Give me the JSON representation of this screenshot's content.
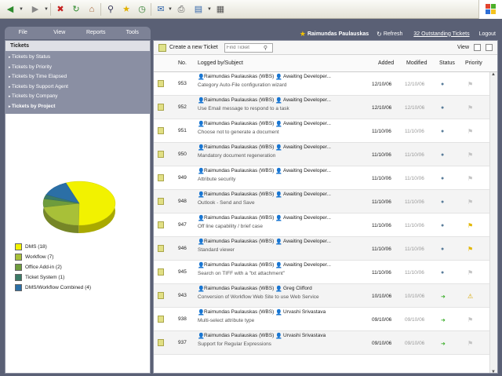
{
  "toolbar": {
    "icons": [
      "back-icon",
      "forward-icon",
      "stop-icon",
      "refresh-icon",
      "home-icon",
      "search-icon",
      "favorites-icon",
      "history-icon",
      "mail-icon",
      "print-icon",
      "edit-icon",
      "discuss-icon"
    ]
  },
  "menu": {
    "items": [
      "File",
      "View",
      "Reports",
      "Tools"
    ]
  },
  "header": {
    "user": "Raimundas Paulauskas",
    "refresh": "Refresh",
    "outstanding": "32 Outstanding Tickets",
    "logout": "Logout"
  },
  "left": {
    "title": "Tickets",
    "nav": [
      "Tickets by Status",
      "Tickets by Priority",
      "Tickets by Time Elapsed",
      "Tickets by Support Agent",
      "Tickets by Company",
      "Tickets by Project"
    ],
    "active_index": 5
  },
  "chart_data": {
    "type": "pie",
    "categories": [
      "DMS",
      "Workflow",
      "Office Add-in",
      "Ticket System",
      "DMS/Workflow Combined"
    ],
    "values": [
      18,
      7,
      2,
      1,
      4
    ],
    "colors": [
      "#f2f200",
      "#a8c038",
      "#6e9c3c",
      "#3a7a66",
      "#2b6fa6"
    ],
    "legend_labels": [
      "DMS (18)",
      "Workflow (7)",
      "Office Add-in (2)",
      "Ticket System (1)",
      "DMS/Workflow Combined (4)"
    ],
    "legend_position": "bottom-left"
  },
  "right": {
    "create": "Create a new Ticket",
    "find_placeholder": "Find Ticket",
    "view": "View",
    "columns": {
      "no": "No.",
      "logged": "Logged by/Subject",
      "added": "Added",
      "modified": "Modified",
      "status": "Status",
      "priority": "Priority"
    },
    "rows": [
      {
        "no": "953",
        "logged": "Raimundas Paulauskas (WBS)",
        "assignee": "Awaiting Developer...",
        "subject": "Category Auto-File configuration wizard",
        "added": "12/10/06",
        "modified": "12/10/06",
        "status": "dot",
        "priority": "flag"
      },
      {
        "no": "952",
        "logged": "Raimundas Paulauskas (WBS)",
        "assignee": "Awaiting Developer...",
        "subject": "Use Email message to respond to a task",
        "added": "12/10/06",
        "modified": "12/10/06",
        "status": "dot",
        "priority": "flag"
      },
      {
        "no": "951",
        "logged": "Raimundas Paulauskas (WBS)",
        "assignee": "Awaiting Developer...",
        "subject": "Choose not to generate a document",
        "added": "11/10/06",
        "modified": "11/10/06",
        "status": "dot",
        "priority": "flag"
      },
      {
        "no": "950",
        "logged": "Raimundas Paulauskas (WBS)",
        "assignee": "Awaiting Developer...",
        "subject": "Mandatory document regeneration",
        "added": "11/10/06",
        "modified": "11/10/06",
        "status": "dot",
        "priority": "flag"
      },
      {
        "no": "949",
        "logged": "Raimundas Paulauskas (WBS)",
        "assignee": "Awaiting Developer...",
        "subject": "Attribute security",
        "added": "11/10/06",
        "modified": "11/10/06",
        "status": "dot",
        "priority": "flag"
      },
      {
        "no": "948",
        "logged": "Raimundas Paulauskas (WBS)",
        "assignee": "Awaiting Developer...",
        "subject": "Outlook - Send and Save",
        "added": "11/10/06",
        "modified": "11/10/06",
        "status": "dot",
        "priority": "flag"
      },
      {
        "no": "947",
        "logged": "Raimundas Paulauskas (WBS)",
        "assignee": "Awaiting Developer...",
        "subject": "Off line capability / brief case",
        "added": "11/10/06",
        "modified": "11/10/06",
        "status": "dot",
        "priority": "flag-high"
      },
      {
        "no": "946",
        "logged": "Raimundas Paulauskas (WBS)",
        "assignee": "Awaiting Developer...",
        "subject": "Standard viewer",
        "added": "11/10/06",
        "modified": "11/10/06",
        "status": "dot",
        "priority": "flag-high"
      },
      {
        "no": "945",
        "logged": "Raimundas Paulauskas (WBS)",
        "assignee": "Awaiting Developer...",
        "subject": "Search on TIFF with a \"txt attachment\"",
        "added": "11/10/06",
        "modified": "11/10/06",
        "status": "dot",
        "priority": "flag"
      },
      {
        "no": "943",
        "logged": "Raimundas Paulauskas (WBS)",
        "assignee": "Greg Clifford",
        "subject": "Conversion of Workflow Web Site to use Web Service",
        "added": "10/10/06",
        "modified": "10/10/06",
        "status": "arrow",
        "priority": "warn"
      },
      {
        "no": "938",
        "logged": "Raimundas Paulauskas (WBS)",
        "assignee": "Urvashi Srivastava",
        "subject": "Multi-select attribute type",
        "added": "09/10/06",
        "modified": "09/10/06",
        "status": "arrow",
        "priority": "flag"
      },
      {
        "no": "937",
        "logged": "Raimundas Paulauskas (WBS)",
        "assignee": "Urvashi Srivastava",
        "subject": "Support for Regular Expressions",
        "added": "09/10/06",
        "modified": "09/10/06",
        "status": "arrow",
        "priority": "flag"
      }
    ]
  }
}
